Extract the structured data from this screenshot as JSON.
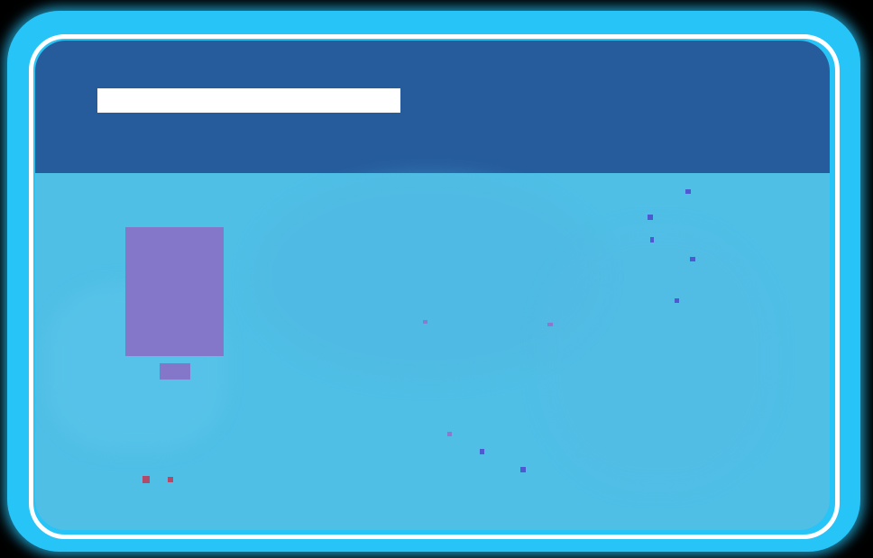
{
  "scene": {
    "glow_color": "#27c4f7",
    "ring_color": "#ffffff",
    "header_color": "#265c9c",
    "field_color": "#4fbfe6"
  },
  "header": {
    "title_bar_color": "#ffffff",
    "title_text": ""
  },
  "field": {
    "block_color": "#8477c9",
    "dot_blue": "#4d5bd0",
    "dot_violet": "#8a79cc",
    "dot_red": "#b24b6a"
  }
}
